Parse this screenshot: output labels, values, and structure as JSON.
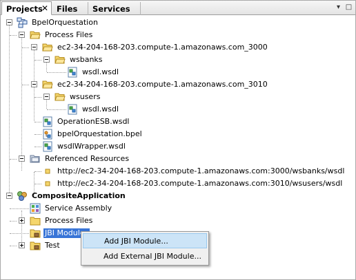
{
  "tabs": [
    {
      "label": "Projects",
      "close": "✕"
    },
    {
      "label": "Files"
    },
    {
      "label": "Services"
    }
  ],
  "window_buttons": {
    "minimize": "▾",
    "maximize": "□"
  },
  "tree": {
    "bpel_project": "BpelOrquestation",
    "process_files": "Process Files",
    "host_3000": "ec2-34-204-168-203.compute-1.amazonaws.com_3000",
    "wsbanks": "wsbanks",
    "wsdl_1": "wsdl.wsdl",
    "host_3010": "ec2-34-204-168-203.compute-1.amazonaws.com_3010",
    "wsusers": "wsusers",
    "wsdl_2": "wsdl.wsdl",
    "operation_esb": "OperationESB.wsdl",
    "bpel_file": "bpelOrquestation.bpel",
    "wsdl_wrapper": "wsdlWrapper.wsdl",
    "referenced_resources": "Referenced Resources",
    "ref_1": "http://ec2-34-204-168-203.compute-1.amazonaws.com:3000/wsbanks/wsdl",
    "ref_2": "http://ec2-34-204-168-203.compute-1.amazonaws.com:3010/wsusers/wsdl",
    "composite_app": "CompositeApplication",
    "service_assembly": "Service Assembly",
    "ca_process_files": "Process Files",
    "jbi_modules": "JBI Modules",
    "test": "Test"
  },
  "context_menu": {
    "items": [
      "Add JBI Module...",
      "Add External JBI Module..."
    ]
  },
  "colors": {
    "selection": "#3875d7",
    "menu_hover": "#cce4f7",
    "folder": "#f5d66c"
  }
}
